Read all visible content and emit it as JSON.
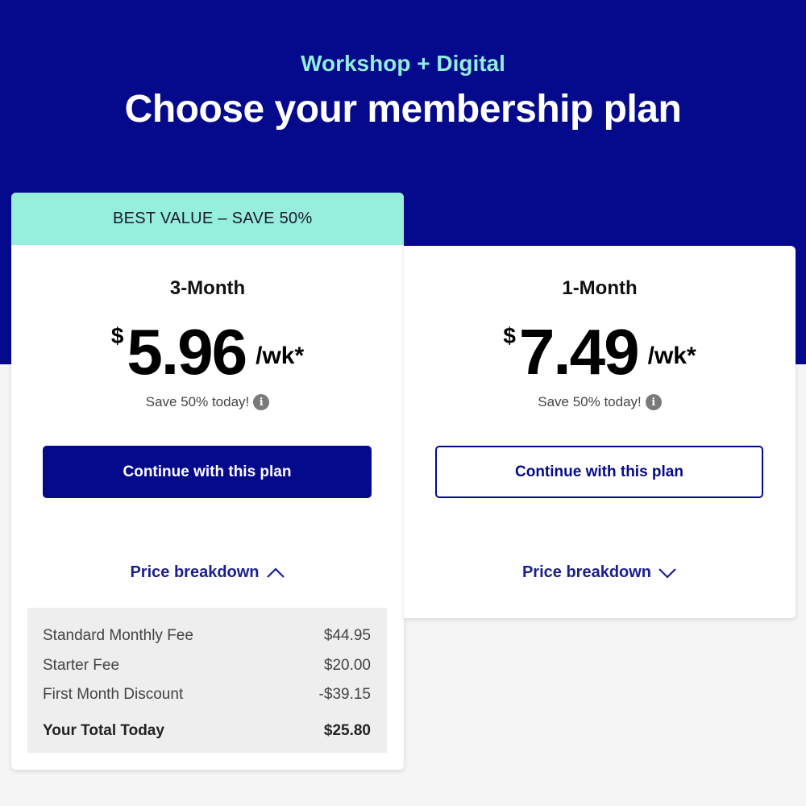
{
  "header": {
    "eyebrow": "Workshop + Digital",
    "title": "Choose your membership plan"
  },
  "plans": [
    {
      "badge": "BEST VALUE – SAVE 50%",
      "name": "3-Month",
      "currency": "$",
      "price": "5.96",
      "unit": "/wk*",
      "save_note": "Save 50% today!",
      "info_glyph": "i",
      "cta_label": "Continue with this plan",
      "cta_style": "primary",
      "breakdown_label": "Price breakdown",
      "breakdown_expanded": true,
      "breakdown": [
        {
          "label": "Standard Monthly Fee",
          "value": "$44.95"
        },
        {
          "label": "Starter Fee",
          "value": "$20.00"
        },
        {
          "label": "First Month Discount",
          "value": "-$39.15"
        }
      ],
      "total": {
        "label": "Your Total Today",
        "value": "$25.80"
      }
    },
    {
      "name": "1-Month",
      "currency": "$",
      "price": "7.49",
      "unit": "/wk*",
      "save_note": "Save 50% today!",
      "info_glyph": "i",
      "cta_label": "Continue with this plan",
      "cta_style": "outline",
      "breakdown_label": "Price breakdown",
      "breakdown_expanded": false
    }
  ],
  "colors": {
    "brand_navy": "#050a8c",
    "accent_mint": "#96eedc",
    "eyebrow_mint": "#94ecdc"
  },
  "icons": {
    "info": "info-circle-icon",
    "chevron_up": "chevron-up-icon",
    "chevron_down": "chevron-down-icon"
  }
}
